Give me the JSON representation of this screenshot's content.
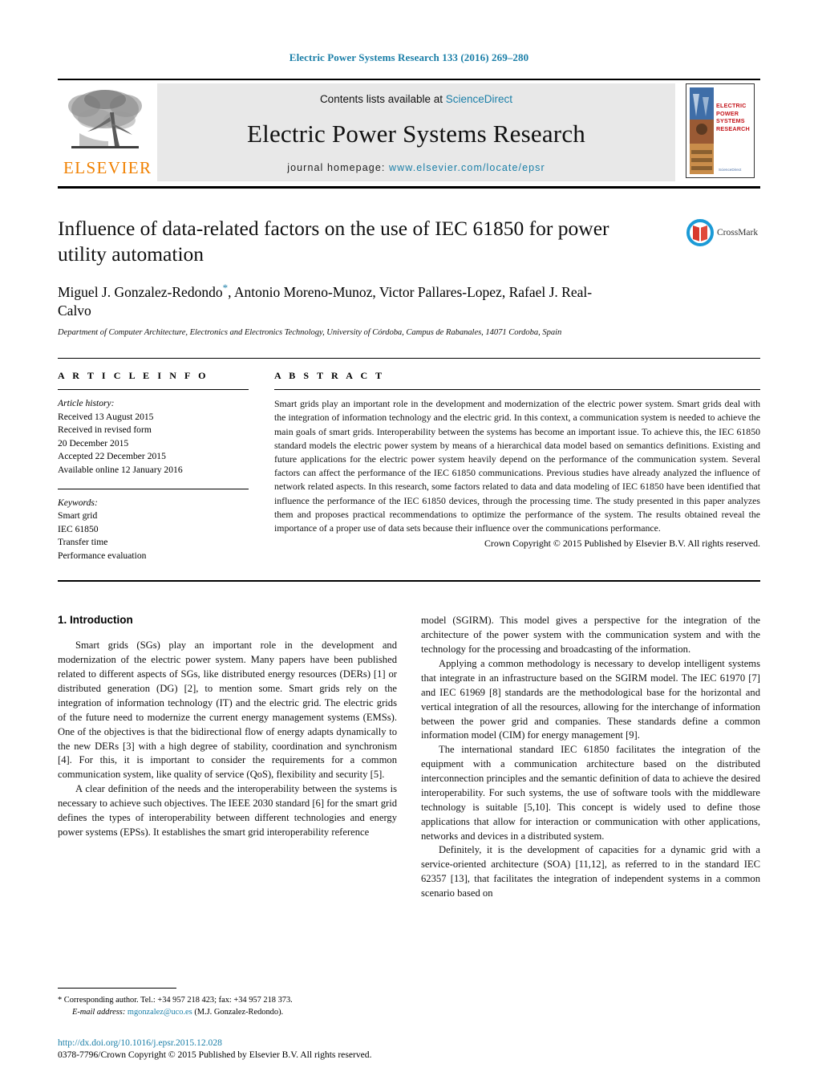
{
  "running_head": "Electric Power Systems Research 133 (2016) 269–280",
  "masthead": {
    "contents_prefix": "Contents lists available at ",
    "contents_link": "ScienceDirect",
    "journal_name": "Electric Power Systems Research",
    "homepage_prefix": "journal homepage: ",
    "homepage_link": "www.elsevier.com/locate/epsr",
    "publisher_logo_text": "ELSEVIER",
    "cover_title_line1": "ELECTRIC POWER",
    "cover_title_line2": "SYSTEMS RESEARCH",
    "cover_publisher": "ScienceDirect"
  },
  "article": {
    "title": "Influence of data-related factors on the use of IEC 61850 for power utility automation",
    "authors": "Miguel J. Gonzalez-Redondo*, Antonio Moreno-Munoz, Victor Pallares-Lopez, Rafael J. Real-Calvo",
    "authors_before_star": "Miguel J. Gonzalez-Redondo",
    "corresponding_marker": "*",
    "authors_after_star": ", Antonio Moreno-Munoz, Victor Pallares-Lopez, Rafael J. Real-Calvo",
    "affiliation": "Department of Computer Architecture, Electronics and Electronics Technology, University of Córdoba, Campus de Rabanales, 14071 Cordoba, Spain",
    "crossmark_label": "CrossMark"
  },
  "article_info": {
    "heading": "A R T I C L E   I N F O",
    "history_title": "Article history:",
    "history": [
      "Received 13 August 2015",
      "Received in revised form",
      "20 December 2015",
      "Accepted 22 December 2015",
      "Available online 12 January 2016"
    ],
    "keywords_title": "Keywords:",
    "keywords": [
      "Smart grid",
      "IEC 61850",
      "Transfer time",
      "Performance evaluation"
    ]
  },
  "abstract": {
    "heading": "A B S T R A C T",
    "text": "Smart grids play an important role in the development and modernization of the electric power system. Smart grids deal with the integration of information technology and the electric grid. In this context, a communication system is needed to achieve the main goals of smart grids. Interoperability between the systems has become an important issue. To achieve this, the IEC 61850 standard models the electric power system by means of a hierarchical data model based on semantics definitions. Existing and future applications for the electric power system heavily depend on the performance of the communication system. Several factors can affect the performance of the IEC 61850 communications. Previous studies have already analyzed the influence of network related aspects. In this research, some factors related to data and data modeling of IEC 61850 have been identified that influence the performance of the IEC 61850 devices, through the processing time. The study presented in this paper analyzes them and proposes practical recommendations to optimize the performance of the system. The results obtained reveal the importance of a proper use of data sets because their influence over the communications performance.",
    "copyright": "Crown Copyright © 2015 Published by Elsevier B.V. All rights reserved."
  },
  "body": {
    "section_heading": "1.  Introduction",
    "left_paragraphs": [
      "Smart grids (SGs) play an important role in the development and modernization of the electric power system. Many papers have been published related to different aspects of SGs, like distributed energy resources (DERs) [1] or distributed generation (DG) [2], to mention some. Smart grids rely on the integration of information technology (IT) and the electric grid. The electric grids of the future need to modernize the current energy management systems (EMSs). One of the objectives is that the bidirectional flow of energy adapts dynamically to the new DERs [3] with a high degree of stability, coordination and synchronism [4]. For this, it is important to consider the requirements for a common communication system, like quality of service (QoS), flexibility and security [5].",
      "A clear definition of the needs and the interoperability between the systems is necessary to achieve such objectives. The IEEE 2030 standard [6] for the smart grid defines the types of interoperability between different technologies and energy power systems (EPSs). It establishes the smart grid interoperability reference"
    ],
    "right_paragraphs": [
      "model (SGIRM). This model gives a perspective for the integration of the architecture of the power system with the communication system and with the technology for the processing and broadcasting of the information.",
      "Applying a common methodology is necessary to develop intelligent systems that integrate in an infrastructure based on the SGIRM model. The IEC 61970 [7] and IEC 61969 [8] standards are the methodological base for the horizontal and vertical integration of all the resources, allowing for the interchange of information between the power grid and companies. These standards define a common information model (CIM) for energy management [9].",
      "The international standard IEC 61850 facilitates the integration of the equipment with a communication architecture based on the distributed interconnection principles and the semantic definition of data to achieve the desired interoperability. For such systems, the use of software tools with the middleware technology is suitable [5,10]. This concept is widely used to define those applications that allow for interaction or communication with other applications, networks and devices in a distributed system.",
      "Definitely, it is the development of capacities for a dynamic grid with a service-oriented architecture (SOA) [11,12], as referred to in the standard IEC 62357 [13], that facilitates the integration of independent systems in a common scenario based on"
    ]
  },
  "footnotes": {
    "corresponding": "* Corresponding author. Tel.: +34 957 218 423; fax: +34 957 218 373.",
    "email_label": "E-mail address:",
    "email": "mgonzalez@uco.es",
    "email_suffix": "(M.J. Gonzalez-Redondo).",
    "doi": "http://dx.doi.org/10.1016/j.epsr.2015.12.028",
    "issn_copyright": "0378-7796/Crown Copyright © 2015 Published by Elsevier B.V. All rights reserved."
  },
  "colors": {
    "link": "#1b7fa8",
    "elsevier_orange": "#f08000",
    "cover_red": "#c4161c",
    "masthead_grey": "#e8e8e8"
  }
}
